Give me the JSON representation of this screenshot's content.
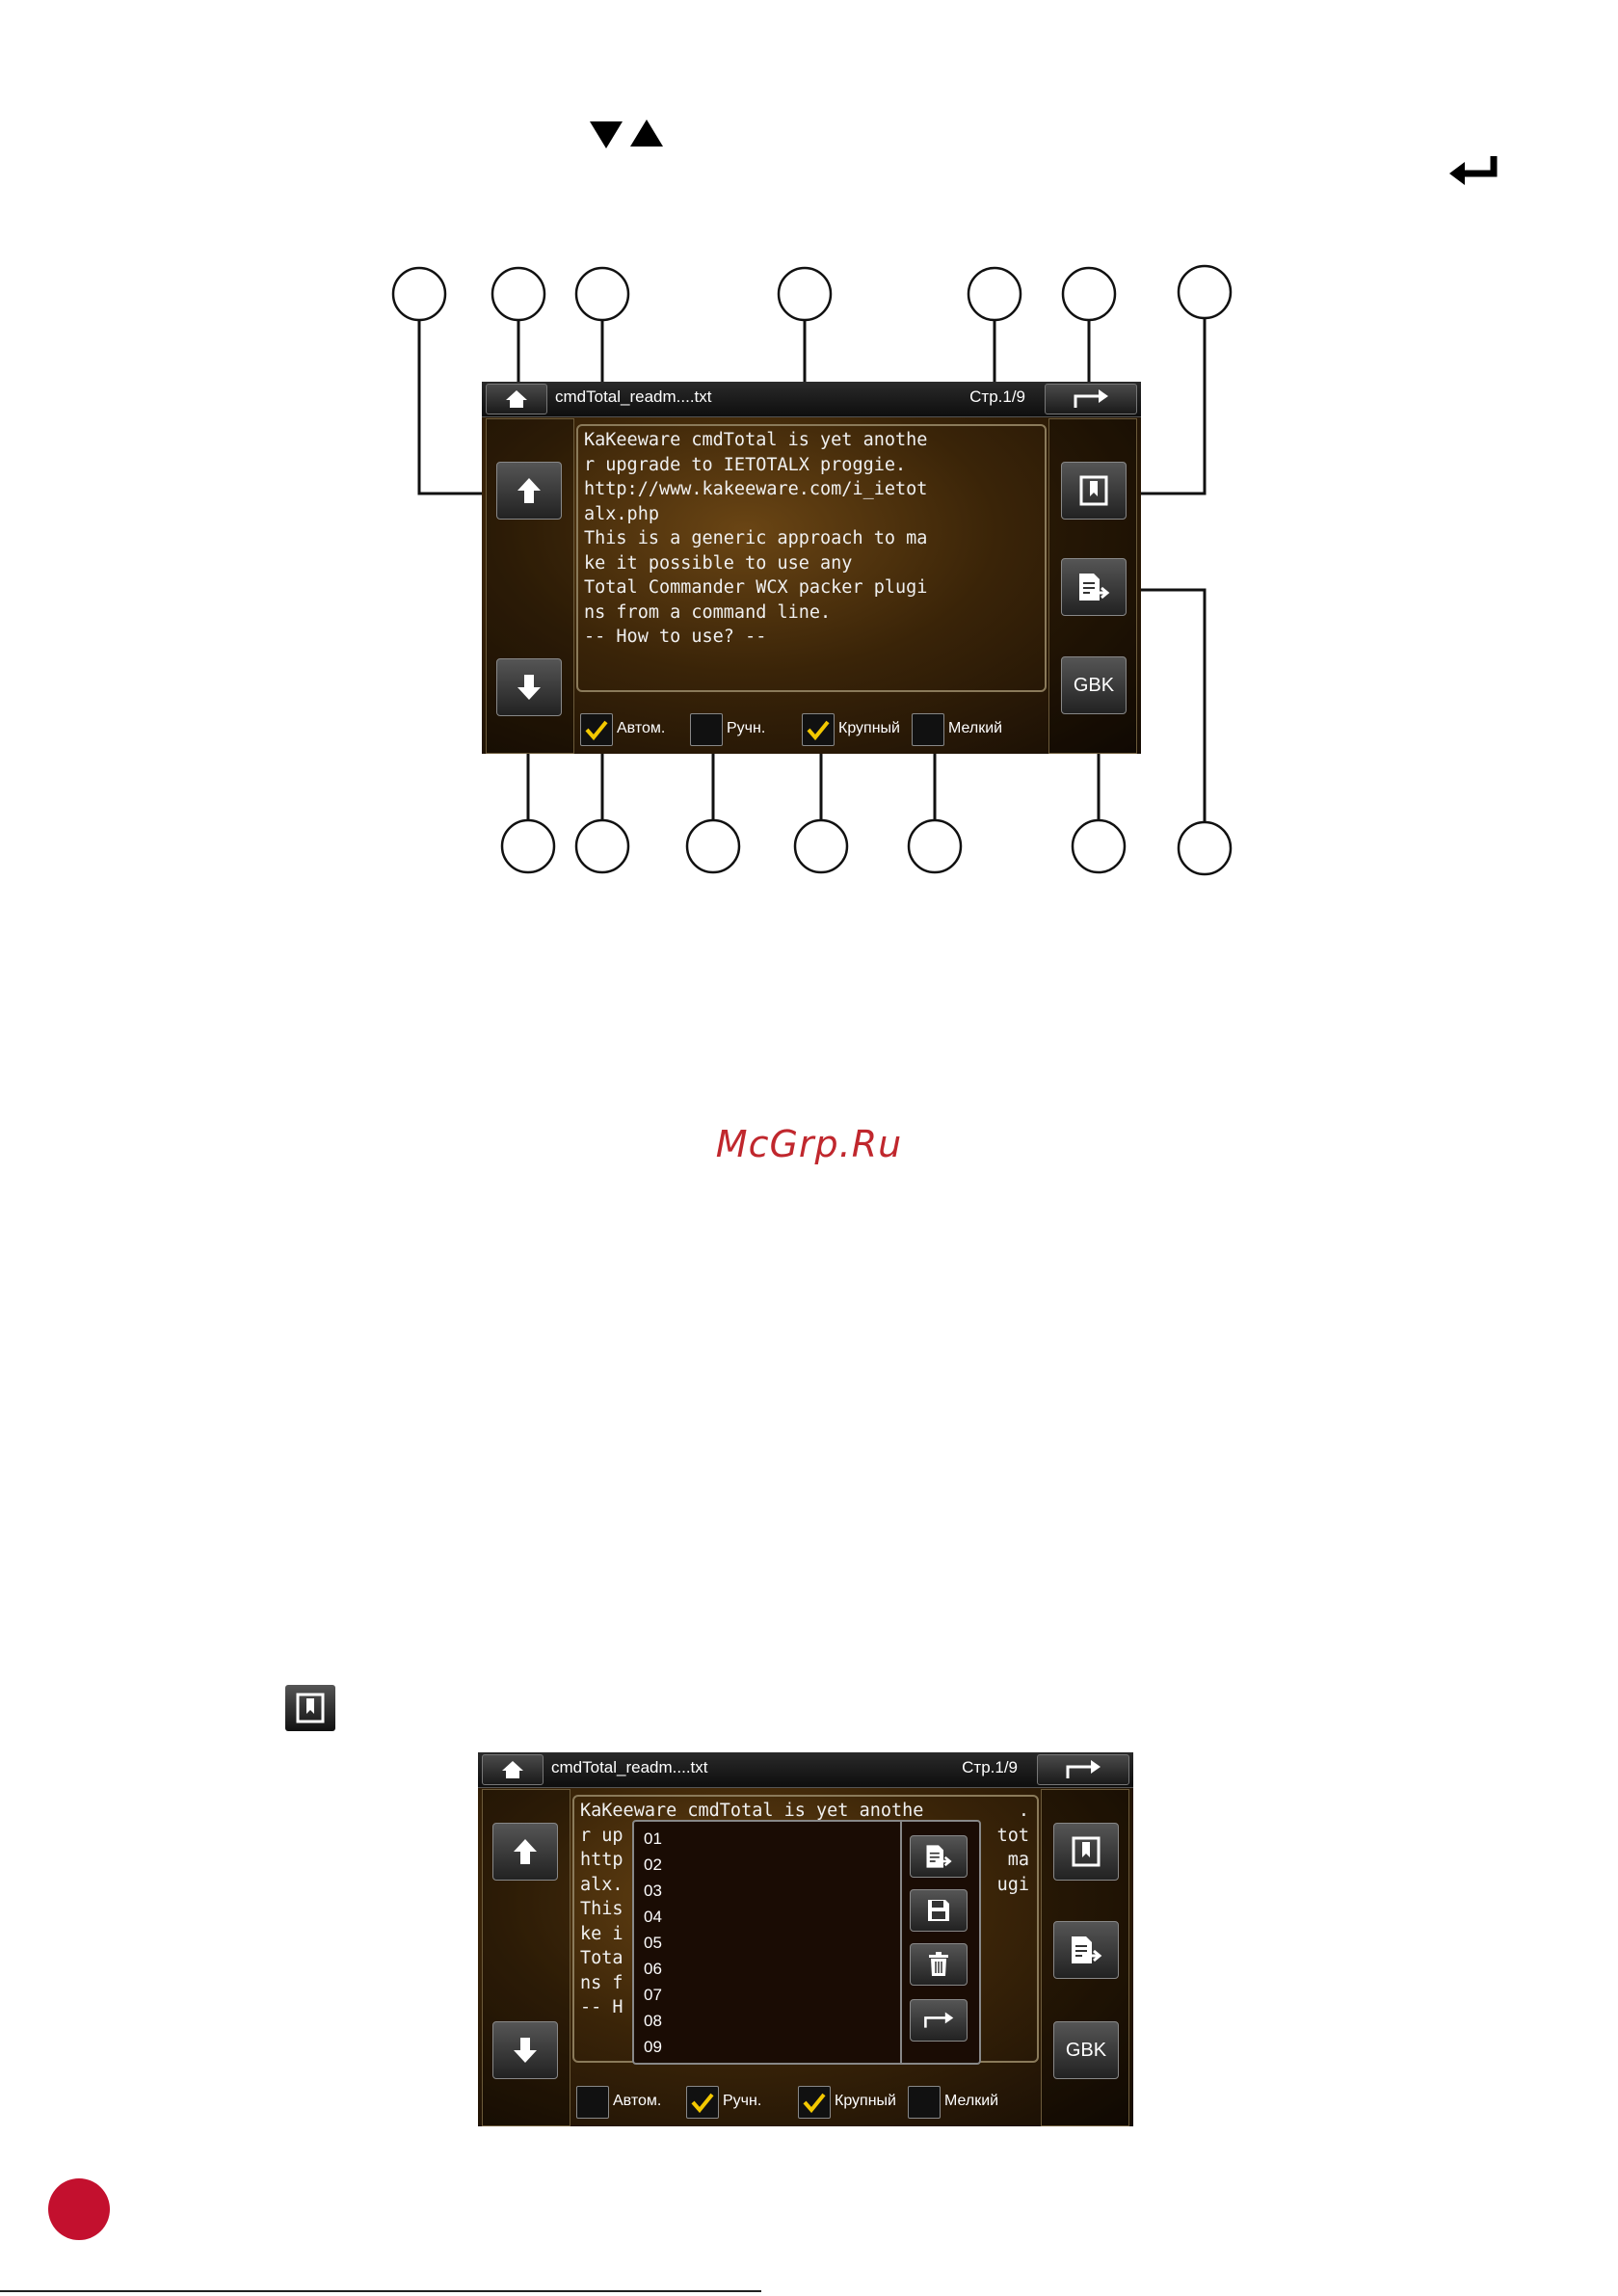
{
  "top_glyphs": {
    "down_triangle": "black-triangle-down-icon",
    "up_triangle": "black-triangle-up-icon",
    "enter": "enter-arrow-icon"
  },
  "watermark": "McGrp.Ru",
  "screen1": {
    "file_name": "cmdTotal_readm....txt",
    "page_info": "Стр.1/9",
    "text_lines": [
      "KaKeeware cmdTotal is yet anothe",
      "r upgrade to IETOTALX proggie.",
      "http://www.kakeeware.com/i_ietot",
      "alx.php",
      "",
      "This is a generic approach to ma",
      "ke it possible to use any",
      "Total Commander WCX packer plugi",
      "ns from a command line.",
      "",
      "-- How to use? --"
    ],
    "checks": [
      {
        "label": "Автом.",
        "checked": true
      },
      {
        "label": "Ручн.",
        "checked": false
      },
      {
        "label": "Крупный",
        "checked": true
      },
      {
        "label": "Мелкий",
        "checked": false
      }
    ],
    "gbk_label": "GBK"
  },
  "screen2": {
    "file_name": "cmdTotal_readm....txt",
    "page_info": "Стр.1/9",
    "text_lines": [
      "KaKeeware cmdTotal is yet anothe",
      "r up",
      "http",
      "alx.",
      "",
      "This",
      "ke i",
      "Tota",
      "ns f",
      "",
      "-- H"
    ],
    "text_right": [
      "",
      ".",
      "tot",
      "",
      "",
      "ma",
      "",
      "ugi",
      "",
      "",
      ""
    ],
    "bookmarks": [
      "01",
      "02",
      "03",
      "04",
      "05",
      "06",
      "07",
      "08",
      "09"
    ],
    "checks": [
      {
        "label": "Автом.",
        "checked": false
      },
      {
        "label": "Ручн.",
        "checked": true
      },
      {
        "label": "Крупный",
        "checked": true
      },
      {
        "label": "Мелкий",
        "checked": false
      }
    ],
    "gbk_label": "GBK"
  },
  "colors": {
    "accent_red": "#c3102e",
    "check_yellow": "#f3c800"
  }
}
